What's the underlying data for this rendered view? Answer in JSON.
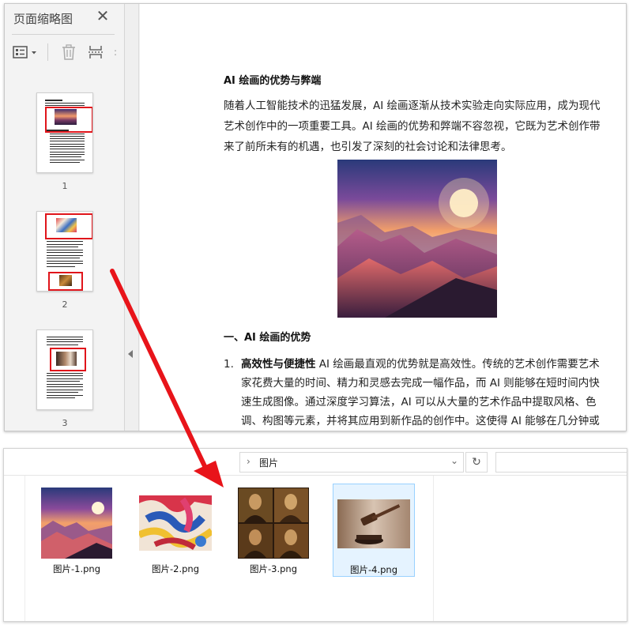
{
  "pdf_viewer": {
    "panel_title": "页面缩略图",
    "close_glyph": "✕",
    "thumbnails": [
      {
        "page_label": "1"
      },
      {
        "page_label": "2"
      },
      {
        "page_label": "3"
      }
    ]
  },
  "document": {
    "title": "AI 绘画的优势与弊端",
    "intro": "随着人工智能技术的迅猛发展，AI 绘画逐渐从技术实验走向实际应用，成为现代艺术创作中的一项重要工具。AI 绘画的优势和弊端不容忽视，它既为艺术创作带来了前所未有的机遇，也引发了深刻的社会讨论和法律思考。",
    "section_heading": "一、AI 绘画的优势",
    "list_items": [
      {
        "number": "1.",
        "lead": "高效性与便捷性",
        "text": " AI 绘画最直观的优势就是高效性。传统的艺术创作需要艺术家花费大量的时间、精力和灵感去完成一幅作品，而 AI 则能够在短时间内快速生成图像。通过深度学习算法，AI 可以从大量的艺术作品中提取风格、色调、构图等元素，并将其应用到新作品的创作中。这使得 AI 能够在几分钟或几小时"
      }
    ]
  },
  "explorer": {
    "breadcrumb_chevron": "›",
    "path_label": "图片",
    "dropdown_glyph": "⌄",
    "refresh_glyph": "↻",
    "files": [
      {
        "name": "图片-1.png",
        "selected": false
      },
      {
        "name": "图片-2.png",
        "selected": false
      },
      {
        "name": "图片-3.png",
        "selected": false
      },
      {
        "name": "图片-4.png",
        "selected": true
      }
    ]
  },
  "colors": {
    "highlight_box": "#e0151b",
    "arrow": "#e8141a",
    "selection_bg": "#e5f3ff",
    "selection_border": "#99d1ff"
  }
}
